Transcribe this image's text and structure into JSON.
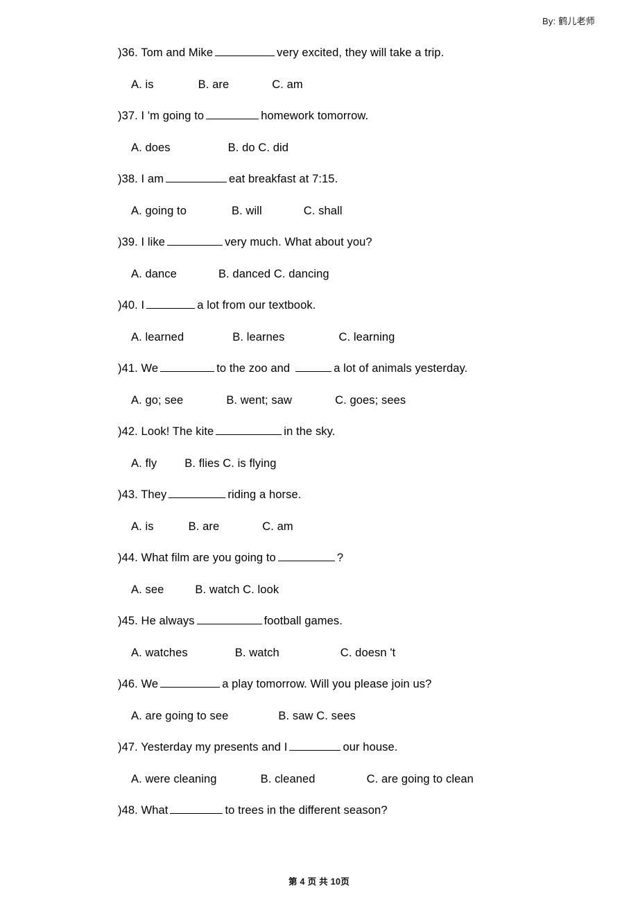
{
  "header": {
    "byline": "By: 鹤儿老师"
  },
  "footer": {
    "page_text": "第 4 页 共 10页",
    "current_page": "4",
    "total_pages": "10"
  },
  "questions": [
    {
      "marker": ")",
      "number": "36.",
      "text_before": "Tom and Mike",
      "blank_width": 86,
      "text_after": "very excited, they will take a trip.",
      "options_raw": "A. is          B. are          C. am",
      "options": [
        "A. is",
        "B. are",
        "C. am"
      ],
      "option_gaps": [
        64,
        62
      ]
    },
    {
      "marker": ")",
      "number": "37.",
      "text_before": "I 'm going to",
      "blank_width": 76,
      "text_after": "homework tomorrow.",
      "options_raw": "A. does          B. do C. did",
      "options": [
        "A. does",
        "B. do C. did"
      ],
      "option_gaps": [
        83
      ]
    },
    {
      "marker": ")",
      "number": "38.",
      "text_before": "I am",
      "blank_width": 88,
      "text_after": "eat breakfast at 7:15.",
      "options_raw": "A. going to          B. will          C. shall",
      "options": [
        "A. going to",
        "B. will",
        "C. shall"
      ],
      "option_gaps": [
        65,
        60
      ]
    },
    {
      "marker": ")",
      "number": "39.",
      "text_before": "I like",
      "blank_width": 80,
      "text_after": "very much. What about you?",
      "options_raw": "A. dance          B. danced C. dancing",
      "options": [
        "A. dance",
        "B. danced C. dancing"
      ],
      "option_gaps": [
        60
      ]
    },
    {
      "marker": ")",
      "number": "40.",
      "text_before": "I",
      "blank_width": 70,
      "text_after": "a lot from our textbook.",
      "options_raw": "A. learned          B. learnes          C. learning",
      "options": [
        "A. learned",
        "B. learnes",
        "C. learning"
      ],
      "option_gaps": [
        70,
        78
      ]
    },
    {
      "marker": ")",
      "number": "41.",
      "text_before": "We",
      "blank_width": 78,
      "text_after": "to the zoo and",
      "blank2_width": 52,
      "text_after2": "a lot of animals yesterday.",
      "options_raw": "A. go; see          B. went; saw          C. goes; sees",
      "options": [
        "A. go; see",
        "B. went; saw",
        "C. goes; sees"
      ],
      "option_gaps": [
        62,
        62
      ]
    },
    {
      "marker": ")",
      "number": "42.",
      "text_before": "Look! The kite",
      "blank_width": 95,
      "text_after": "in the sky.",
      "options_raw": "A. fly     B. flies C. is flying",
      "options": [
        "A. fly",
        "B. flies C. is flying"
      ],
      "option_gaps": [
        40
      ]
    },
    {
      "marker": ")",
      "number": "43.",
      "text_before": "They",
      "blank_width": 82,
      "text_after": "riding a horse.",
      "options_raw": "A. is        B. are          C. am",
      "options": [
        "A. is",
        "B. are",
        "C. am"
      ],
      "option_gaps": [
        50,
        62
      ]
    },
    {
      "marker": ")",
      "number": "44.",
      "text_before": "What film are you going to",
      "blank_width": 82,
      "text_after": "?",
      "options_raw": "A. see        B. watch C. look",
      "options": [
        "A. see",
        "B. watch C. look"
      ],
      "option_gaps": [
        45
      ]
    },
    {
      "marker": ")",
      "number": "45.",
      "text_before": "He always",
      "blank_width": 94,
      "text_after": "football games.",
      "options_raw": "A. watches          B. watch          C. doesn 't",
      "options": [
        "A. watches",
        "B. watch",
        "C. doesn 't"
      ],
      "option_gaps": [
        68,
        88
      ]
    },
    {
      "marker": ")",
      "number": "46.",
      "text_before": "We",
      "blank_width": 86,
      "text_after": "a play tomorrow. Will you please join us?",
      "options_raw": "A. are going to see          B. saw C. sees",
      "options": [
        "A. are going to see",
        "B. saw C. sees"
      ],
      "option_gaps": [
        72
      ]
    },
    {
      "marker": ")",
      "number": "47.",
      "text_before": "Yesterday my presents and I",
      "blank_width": 74,
      "text_after": "our house.",
      "options_raw": "A. were cleaning          B. cleaned          C. are going to clean",
      "options": [
        "A. were cleaning",
        "B. cleaned",
        "C. are going to clean"
      ],
      "option_gaps": [
        63,
        74
      ]
    },
    {
      "marker": ")",
      "number": "48.",
      "text_before": "What",
      "blank_width": 76,
      "text_after": "to trees in the different season?",
      "options_raw": "",
      "options": [],
      "option_gaps": []
    }
  ]
}
